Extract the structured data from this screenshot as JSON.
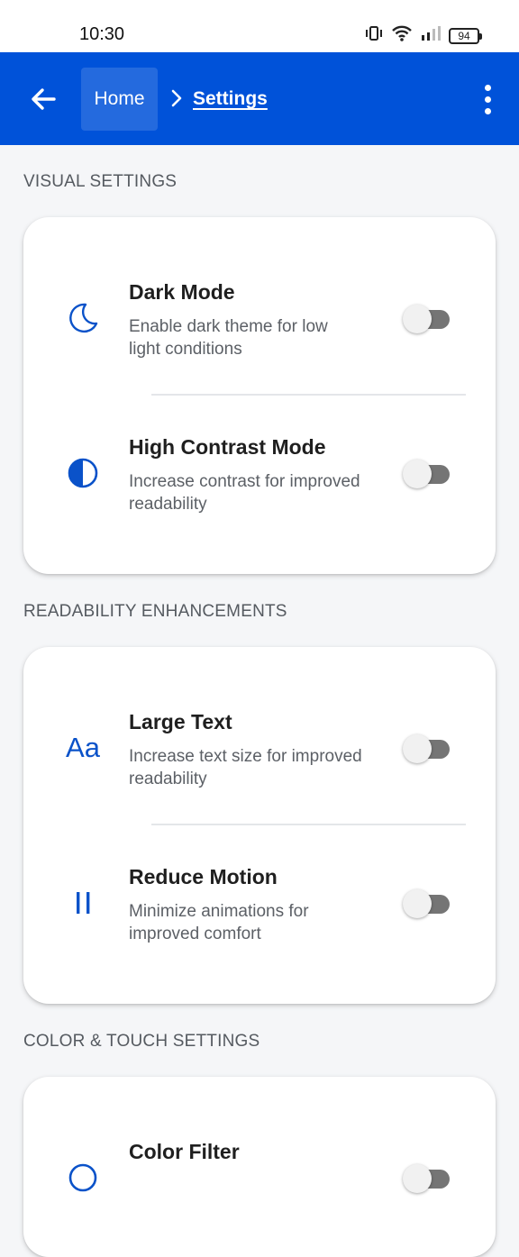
{
  "status": {
    "time": "10:30",
    "battery": "94"
  },
  "appbar": {
    "breadcrumb_home": "Home",
    "breadcrumb_current": "Settings"
  },
  "sections": [
    {
      "title": "VISUAL SETTINGS",
      "items": [
        {
          "title": "Dark Mode",
          "desc": "Enable dark theme for low light conditions",
          "icon": "moon-icon",
          "enabled": false
        },
        {
          "title": "High Contrast Mode",
          "desc": "Increase contrast for improved readability",
          "icon": "contrast-icon",
          "enabled": false
        }
      ]
    },
    {
      "title": "READABILITY ENHANCEMENTS",
      "items": [
        {
          "title": "Large Text",
          "desc": "Increase text size for improved readability",
          "icon": "text-size-icon",
          "icon_text": "Aa",
          "enabled": false
        },
        {
          "title": "Reduce Motion",
          "desc": "Minimize animations for improved comfort",
          "icon": "pause-icon",
          "enabled": false
        }
      ]
    },
    {
      "title": "COLOR & TOUCH SETTINGS",
      "items": [
        {
          "title": "Color Filter",
          "icon": "color-filter-icon",
          "enabled": false
        }
      ]
    }
  ],
  "colors": {
    "accent": "#0052d9",
    "icon": "#0a52c9",
    "background": "#f5f6f8"
  }
}
